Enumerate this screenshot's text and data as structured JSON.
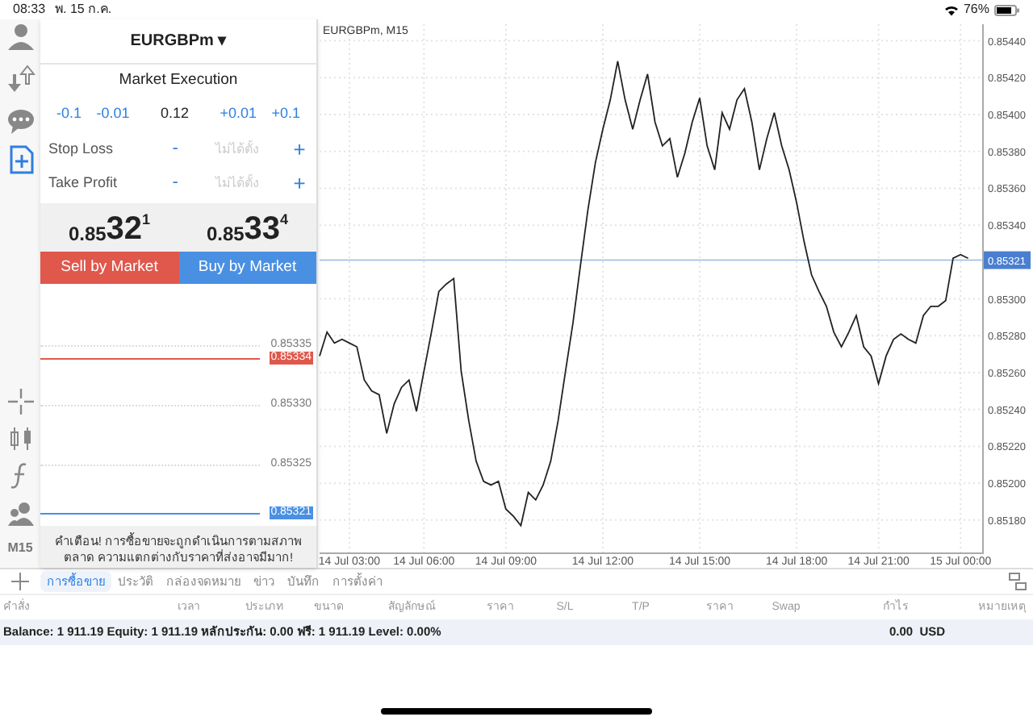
{
  "status_bar": {
    "time": "08:33",
    "date": "พ. 15 ก.ค.",
    "battery": "76%"
  },
  "order_panel": {
    "symbol": "EURGBPm",
    "symbol_caret": "▾",
    "execution": "Market Execution",
    "volume_steps": [
      {
        "label": "-0.1"
      },
      {
        "label": "-0.01"
      },
      {
        "label": "0.12",
        "kind": "value"
      },
      {
        "label": "+0.01"
      },
      {
        "label": "+0.1"
      }
    ],
    "fields": [
      {
        "label": "Stop Loss",
        "minus": "-",
        "placeholder": "ไม่ได้ตั้ง",
        "plus": "+"
      },
      {
        "label": "Take Profit",
        "minus": "-",
        "placeholder": "ไม่ได้ตั้ง",
        "plus": "+"
      }
    ],
    "bid": {
      "small": "0.85",
      "big": "32",
      "sup": "1"
    },
    "ask": {
      "small": "0.85",
      "big": "33",
      "sup": "4"
    },
    "sell_button": "Sell by Market",
    "buy_button": "Buy by Market",
    "price_levels": [
      {
        "label": "0.85335",
        "kind": "grid"
      },
      {
        "label": "0.85334",
        "kind": "ask"
      },
      {
        "label": "0.85330",
        "kind": "grid"
      },
      {
        "label": "0.85325",
        "kind": "grid"
      },
      {
        "label": "0.85321",
        "kind": "bid"
      }
    ],
    "warning": "คำเตือน! การซื้อขายจะถูกดำเนินการตามสภาพตลาด ความแตกต่างกับราคาที่ส่งอาจมีมาก!"
  },
  "toolbar": {
    "timeframe": "M15"
  },
  "chart": {
    "chart_data": {
      "type": "line",
      "title": "EURGBPm, M15",
      "categories": [
        null,
        null,
        null,
        null,
        "14 Jul 03:00",
        null,
        null,
        null,
        null,
        null,
        null,
        null,
        null,
        null,
        "14 Jul 06:00",
        null,
        null,
        null,
        null,
        null,
        null,
        null,
        null,
        null,
        null,
        "14 Jul 09:00",
        null,
        null,
        null,
        null,
        null,
        null,
        null,
        null,
        null,
        null,
        null,
        null,
        "14 Jul 12:00",
        null,
        null,
        null,
        null,
        null,
        null,
        null,
        null,
        null,
        null,
        null,
        null,
        "14 Jul 15:00",
        null,
        null,
        null,
        null,
        null,
        null,
        null,
        null,
        null,
        null,
        null,
        null,
        "14 Jul 18:00",
        null,
        null,
        null,
        null,
        null,
        null,
        null,
        null,
        null,
        null,
        "14 Jul 21:00",
        null,
        null,
        null,
        null,
        null,
        null,
        null,
        null,
        null,
        null,
        "15 Jul 00:00",
        null
      ],
      "series": [
        {
          "color": "#222222",
          "values": [
            0.85269,
            0.85282,
            0.85276,
            0.85278,
            0.85276,
            0.85274,
            0.85256,
            0.8525,
            0.85248,
            0.85227,
            0.85243,
            0.85252,
            0.85256,
            0.85239,
            0.85261,
            0.85282,
            0.85304,
            0.85308,
            0.85311,
            0.85261,
            0.85234,
            0.85212,
            0.85201,
            0.85199,
            0.85201,
            0.85186,
            0.85182,
            0.85177,
            0.85195,
            0.85191,
            0.85199,
            0.85212,
            0.85234,
            0.85261,
            0.85287,
            0.85318,
            0.85348,
            0.85374,
            0.85392,
            0.85408,
            0.85429,
            0.85408,
            0.85392,
            0.85408,
            0.85422,
            0.85396,
            0.85383,
            0.85387,
            0.85366,
            0.85379,
            0.85396,
            0.85409,
            0.85383,
            0.8537,
            0.85401,
            0.85392,
            0.85408,
            0.85414,
            0.85396,
            0.8537,
            0.85387,
            0.85401,
            0.85383,
            0.8537,
            0.85352,
            0.85331,
            0.85313,
            0.85304,
            0.85296,
            0.85282,
            0.85274,
            0.85282,
            0.85291,
            0.85274,
            0.85269,
            0.85254,
            0.85269,
            0.85278,
            0.85281,
            0.85278,
            0.85276,
            0.85291,
            0.85296,
            0.85296,
            0.85299,
            0.85322,
            0.85324,
            0.85322
          ]
        }
      ],
      "grid": true,
      "ylim": [
        0.85162,
        0.85449
      ],
      "yticks": [
        {
          "value": 0.8518,
          "label": "0.85180"
        },
        {
          "value": 0.852,
          "label": "0.85200"
        },
        {
          "value": 0.8522,
          "label": "0.85220"
        },
        {
          "value": 0.8524,
          "label": "0.85240"
        },
        {
          "value": 0.8526,
          "label": "0.85260"
        },
        {
          "value": 0.8528,
          "label": "0.85280"
        },
        {
          "value": 0.853,
          "label": "0.85300"
        },
        {
          "value": 0.8534,
          "label": "0.85340"
        },
        {
          "value": 0.8536,
          "label": "0.85360"
        },
        {
          "value": 0.8538,
          "label": "0.85380"
        },
        {
          "value": 0.854,
          "label": "0.85400"
        },
        {
          "value": 0.8542,
          "label": "0.85420"
        },
        {
          "value": 0.8544,
          "label": "0.85440"
        }
      ],
      "ref_lines": [
        {
          "axis": "y",
          "value": 0.85321,
          "label": "0.85321"
        }
      ]
    }
  },
  "tabs": [
    {
      "label": "การซื้อขาย",
      "selected": true
    },
    {
      "label": "ประวัติ",
      "selected": false
    },
    {
      "label": "กล่องจดหมาย",
      "selected": false
    },
    {
      "label": "ข่าว",
      "selected": false
    },
    {
      "label": "บันทึก",
      "selected": false
    },
    {
      "label": "การตั้งค่า",
      "selected": false
    }
  ],
  "table": {
    "columns": [
      "คำสั่ง",
      "เวลา",
      "ประเภท",
      "ขนาด",
      "สัญลักษณ์",
      "ราคา",
      "S/L",
      "T/P",
      "ราคา",
      "Swap",
      "กำไร",
      "หมายเหตุ"
    ],
    "summary": "Balance: 1 911.19 Equity: 1 911.19 หลักประกัน: 0.00 ฟรี: 1 911.19 Level: 0.00%",
    "profit": "0.00",
    "currency": "USD"
  }
}
